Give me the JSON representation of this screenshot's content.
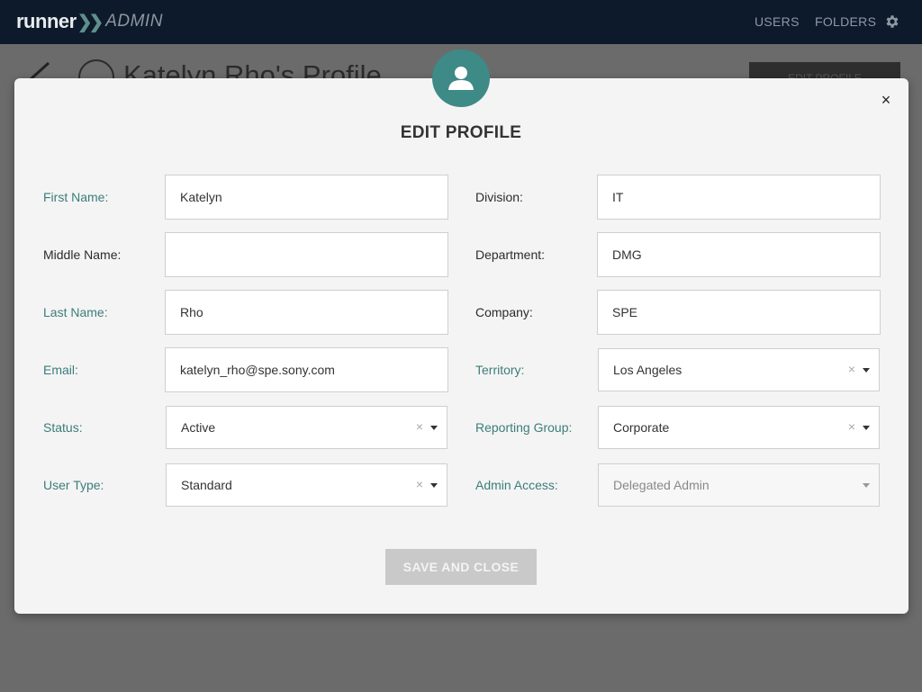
{
  "topnav": {
    "logo_runner": "runner",
    "logo_chevrons": "❯❯",
    "logo_admin": "ADMIN",
    "users": "USERS",
    "folders": "FOLDERS",
    "settings_icon": "gear-icon"
  },
  "background": {
    "page_title": "Katelyn Rho's Profile",
    "edit_profile_button": "EDIT PROFILE"
  },
  "modal": {
    "title": "EDIT PROFILE",
    "close": "×",
    "save_button": "SAVE AND CLOSE",
    "accent_color": "#3d8a87"
  },
  "fields": {
    "first_name": {
      "label": "First Name:",
      "value": "Katelyn"
    },
    "middle_name": {
      "label": "Middle Name:",
      "value": ""
    },
    "last_name": {
      "label": "Last Name:",
      "value": "Rho"
    },
    "email": {
      "label": "Email:",
      "value": "katelyn_rho@spe.sony.com"
    },
    "status": {
      "label": "Status:",
      "value": "Active"
    },
    "user_type": {
      "label": "User Type:",
      "value": "Standard"
    },
    "division": {
      "label": "Division:",
      "value": "IT"
    },
    "department": {
      "label": "Department:",
      "value": "DMG"
    },
    "company": {
      "label": "Company:",
      "value": "SPE"
    },
    "territory": {
      "label": "Territory:",
      "value": "Los Angeles"
    },
    "reporting_group": {
      "label": "Reporting Group:",
      "value": "Corporate"
    },
    "admin_access": {
      "label": "Admin Access:",
      "value": "Delegated Admin"
    }
  },
  "clear_glyph": "×"
}
